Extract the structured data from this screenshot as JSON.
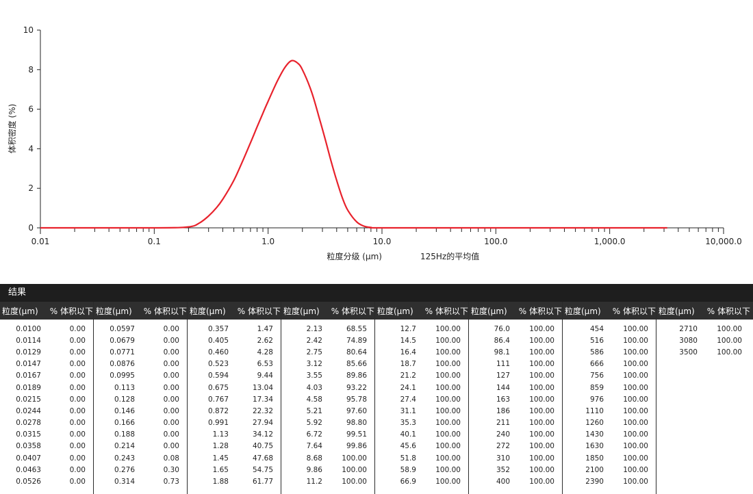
{
  "chart_data": {
    "type": "line",
    "xscale": "log",
    "xlim": [
      0.01,
      10000
    ],
    "ylim": [
      0,
      10
    ],
    "xticks": [
      "0.01",
      "0.1",
      "1.0",
      "10.0",
      "100.0",
      "1,000.0",
      "10,000.0"
    ],
    "yticks": [
      "0",
      "2",
      "4",
      "6",
      "8",
      "10"
    ],
    "xlabel": "粒度分级 (μm)",
    "xlabel_note": "125Hz的平均值",
    "ylabel": "体积密度 (%)",
    "line_color": "#e8222c",
    "series": [
      {
        "x": [
          0.01,
          0.1,
          0.2,
          0.25,
          0.3,
          0.35,
          0.4,
          0.5,
          0.6,
          0.7,
          0.8,
          0.9,
          1.0,
          1.2,
          1.4,
          1.6,
          1.8,
          2.0,
          2.4,
          2.8,
          3.2,
          3.6,
          4.0,
          4.5,
          5.0,
          6.0,
          7.0,
          8.0,
          10.0,
          100,
          1000,
          3200
        ],
        "y": [
          0,
          0,
          0.05,
          0.25,
          0.6,
          1.0,
          1.45,
          2.4,
          3.4,
          4.3,
          5.1,
          5.8,
          6.4,
          7.4,
          8.1,
          8.45,
          8.35,
          8.0,
          6.9,
          5.6,
          4.4,
          3.3,
          2.4,
          1.5,
          0.9,
          0.3,
          0.08,
          0.02,
          0,
          0,
          0,
          0
        ]
      }
    ]
  },
  "results": {
    "title": "结果",
    "size_header": "粒度(μm)",
    "vol_header": "% 体积以下",
    "columns": [
      [
        [
          "0.0100",
          "0.00"
        ],
        [
          "0.0114",
          "0.00"
        ],
        [
          "0.0129",
          "0.00"
        ],
        [
          "0.0147",
          "0.00"
        ],
        [
          "0.0167",
          "0.00"
        ],
        [
          "0.0189",
          "0.00"
        ],
        [
          "0.0215",
          "0.00"
        ],
        [
          "0.0244",
          "0.00"
        ],
        [
          "0.0278",
          "0.00"
        ],
        [
          "0.0315",
          "0.00"
        ],
        [
          "0.0358",
          "0.00"
        ],
        [
          "0.0407",
          "0.00"
        ],
        [
          "0.0463",
          "0.00"
        ],
        [
          "0.0526",
          "0.00"
        ]
      ],
      [
        [
          "0.0597",
          "0.00"
        ],
        [
          "0.0679",
          "0.00"
        ],
        [
          "0.0771",
          "0.00"
        ],
        [
          "0.0876",
          "0.00"
        ],
        [
          "0.0995",
          "0.00"
        ],
        [
          "0.113",
          "0.00"
        ],
        [
          "0.128",
          "0.00"
        ],
        [
          "0.146",
          "0.00"
        ],
        [
          "0.166",
          "0.00"
        ],
        [
          "0.188",
          "0.00"
        ],
        [
          "0.214",
          "0.00"
        ],
        [
          "0.243",
          "0.08"
        ],
        [
          "0.276",
          "0.30"
        ],
        [
          "0.314",
          "0.73"
        ]
      ],
      [
        [
          "0.357",
          "1.47"
        ],
        [
          "0.405",
          "2.62"
        ],
        [
          "0.460",
          "4.28"
        ],
        [
          "0.523",
          "6.53"
        ],
        [
          "0.594",
          "9.44"
        ],
        [
          "0.675",
          "13.04"
        ],
        [
          "0.767",
          "17.34"
        ],
        [
          "0.872",
          "22.32"
        ],
        [
          "0.991",
          "27.94"
        ],
        [
          "1.13",
          "34.12"
        ],
        [
          "1.28",
          "40.75"
        ],
        [
          "1.45",
          "47.68"
        ],
        [
          "1.65",
          "54.75"
        ],
        [
          "1.88",
          "61.77"
        ]
      ],
      [
        [
          "2.13",
          "68.55"
        ],
        [
          "2.42",
          "74.89"
        ],
        [
          "2.75",
          "80.64"
        ],
        [
          "3.12",
          "85.66"
        ],
        [
          "3.55",
          "89.86"
        ],
        [
          "4.03",
          "93.22"
        ],
        [
          "4.58",
          "95.78"
        ],
        [
          "5.21",
          "97.60"
        ],
        [
          "5.92",
          "98.80"
        ],
        [
          "6.72",
          "99.51"
        ],
        [
          "7.64",
          "99.86"
        ],
        [
          "8.68",
          "100.00"
        ],
        [
          "9.86",
          "100.00"
        ],
        [
          "11.2",
          "100.00"
        ]
      ],
      [
        [
          "12.7",
          "100.00"
        ],
        [
          "14.5",
          "100.00"
        ],
        [
          "16.4",
          "100.00"
        ],
        [
          "18.7",
          "100.00"
        ],
        [
          "21.2",
          "100.00"
        ],
        [
          "24.1",
          "100.00"
        ],
        [
          "27.4",
          "100.00"
        ],
        [
          "31.1",
          "100.00"
        ],
        [
          "35.3",
          "100.00"
        ],
        [
          "40.1",
          "100.00"
        ],
        [
          "45.6",
          "100.00"
        ],
        [
          "51.8",
          "100.00"
        ],
        [
          "58.9",
          "100.00"
        ],
        [
          "66.9",
          "100.00"
        ]
      ],
      [
        [
          "76.0",
          "100.00"
        ],
        [
          "86.4",
          "100.00"
        ],
        [
          "98.1",
          "100.00"
        ],
        [
          "111",
          "100.00"
        ],
        [
          "127",
          "100.00"
        ],
        [
          "144",
          "100.00"
        ],
        [
          "163",
          "100.00"
        ],
        [
          "186",
          "100.00"
        ],
        [
          "211",
          "100.00"
        ],
        [
          "240",
          "100.00"
        ],
        [
          "272",
          "100.00"
        ],
        [
          "310",
          "100.00"
        ],
        [
          "352",
          "100.00"
        ],
        [
          "400",
          "100.00"
        ]
      ],
      [
        [
          "454",
          "100.00"
        ],
        [
          "516",
          "100.00"
        ],
        [
          "586",
          "100.00"
        ],
        [
          "666",
          "100.00"
        ],
        [
          "756",
          "100.00"
        ],
        [
          "859",
          "100.00"
        ],
        [
          "976",
          "100.00"
        ],
        [
          "1110",
          "100.00"
        ],
        [
          "1260",
          "100.00"
        ],
        [
          "1430",
          "100.00"
        ],
        [
          "1630",
          "100.00"
        ],
        [
          "1850",
          "100.00"
        ],
        [
          "2100",
          "100.00"
        ],
        [
          "2390",
          "100.00"
        ]
      ],
      [
        [
          "2710",
          "100.00"
        ],
        [
          "3080",
          "100.00"
        ],
        [
          "3500",
          "100.00"
        ]
      ]
    ]
  }
}
